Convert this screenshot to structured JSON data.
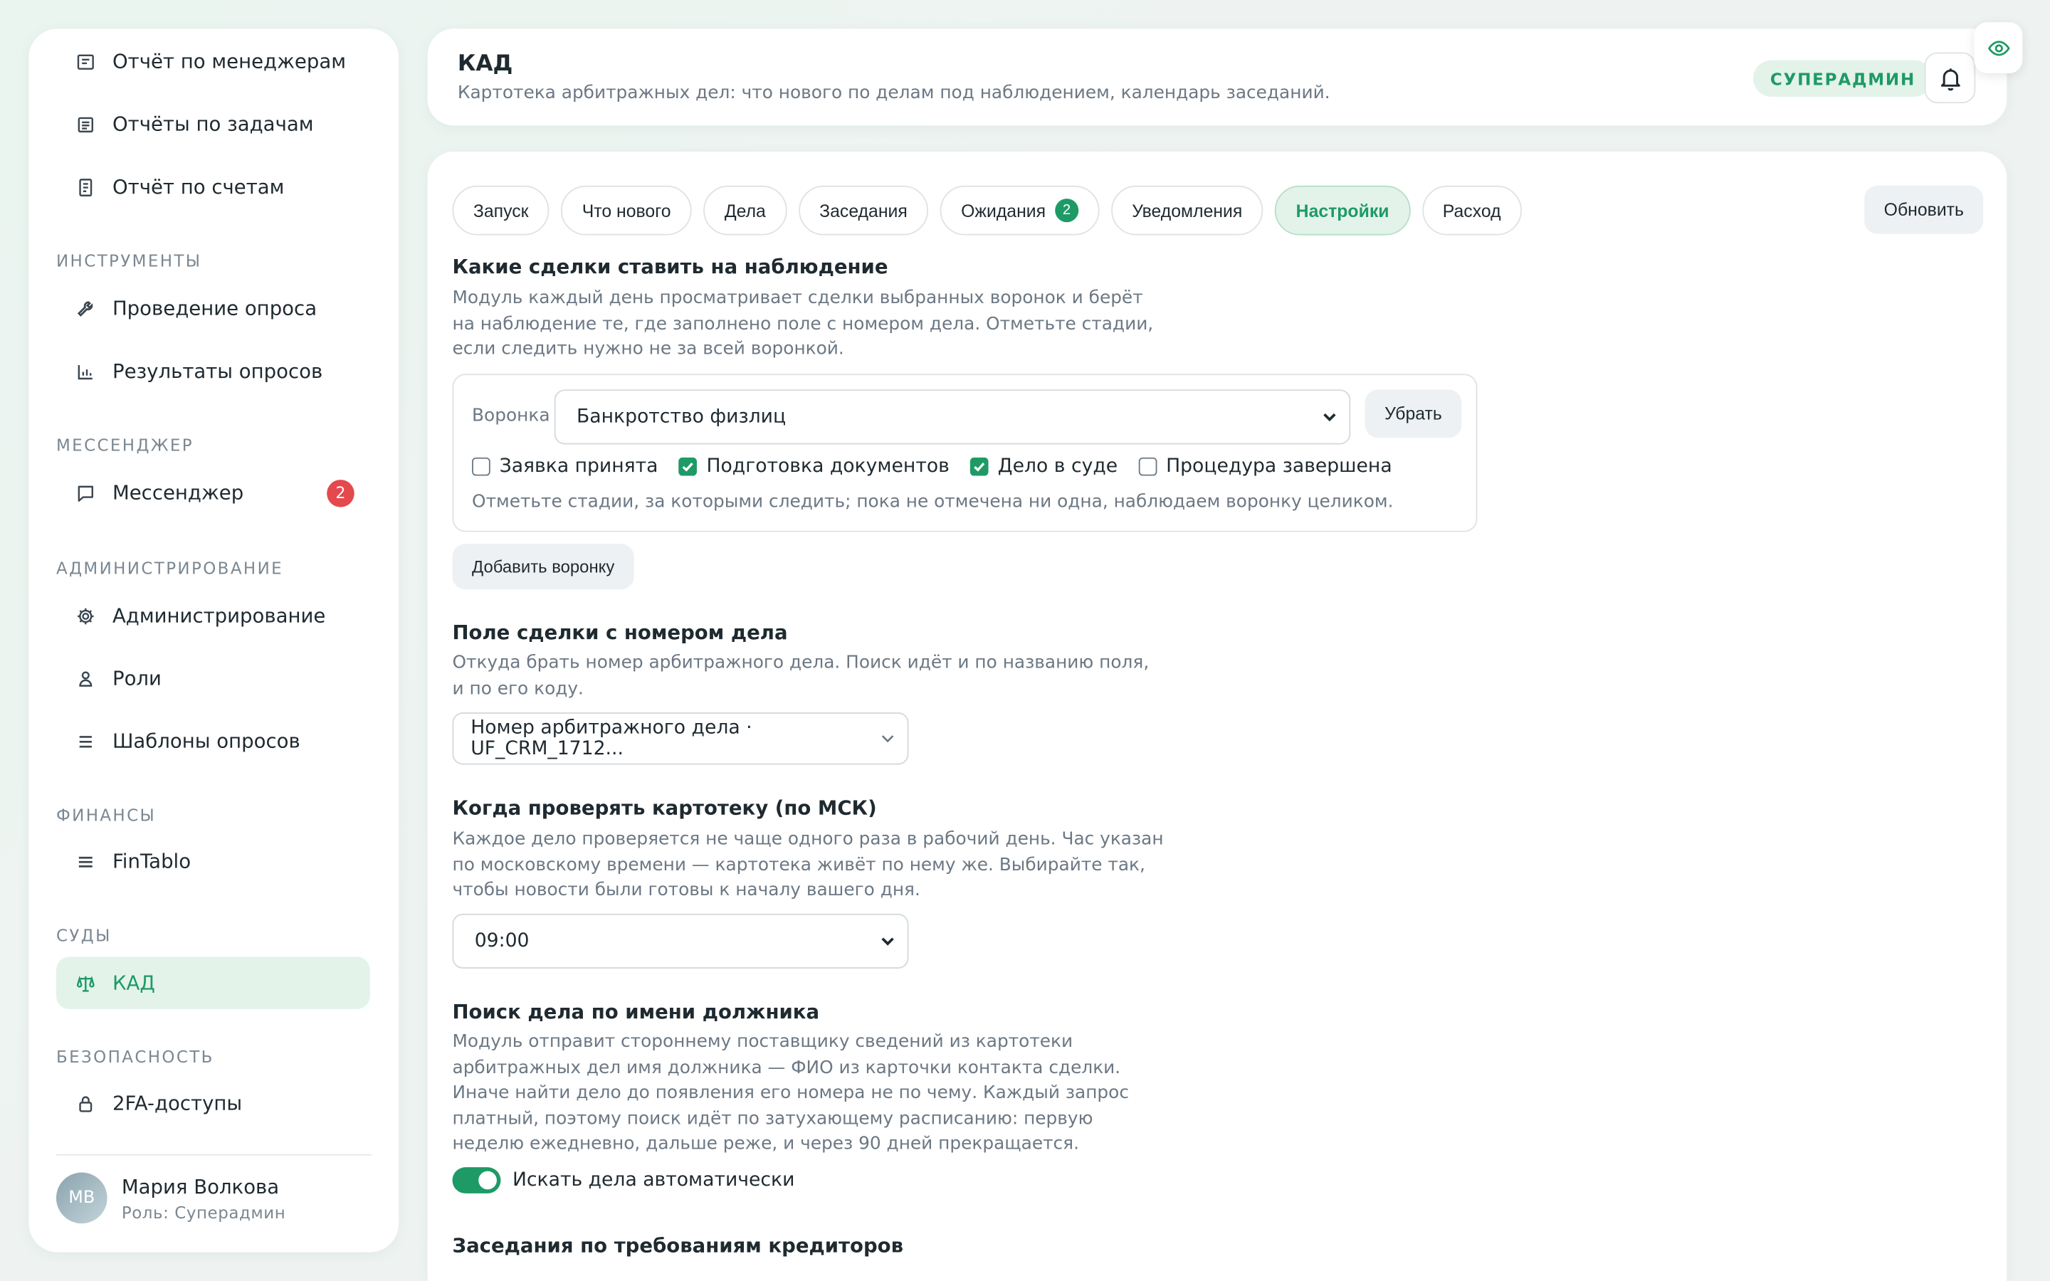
{
  "sidebar": {
    "items_top": [
      {
        "label": "Отчёт по менеджерам",
        "icon": "report-icon"
      },
      {
        "label": "Отчёты по задачам",
        "icon": "tasks-report-icon"
      },
      {
        "label": "Отчёт по счетам",
        "icon": "invoice-icon"
      }
    ],
    "sections": {
      "tools": "ИНСТРУМЕНТЫ",
      "messenger": "МЕССЕНДЖЕР",
      "admin": "АДМИНИСТРИРОВАНИЕ",
      "finance": "ФИНАНСЫ",
      "courts": "СУДЫ",
      "security": "БЕЗОПАСНОСТЬ"
    },
    "tools_items": [
      {
        "label": "Проведение опроса",
        "icon": "wrench-icon"
      },
      {
        "label": "Результаты опросов",
        "icon": "bar-chart-icon"
      }
    ],
    "messenger_item": {
      "label": "Мессенджер",
      "badge": "2",
      "icon": "chat-icon"
    },
    "admin_items": [
      {
        "label": "Администрирование",
        "icon": "gear-icon"
      },
      {
        "label": "Роли",
        "icon": "person-icon"
      },
      {
        "label": "Шаблоны опросов",
        "icon": "list-icon"
      }
    ],
    "finance_item": {
      "label": "FinTablo",
      "icon": "menu-icon"
    },
    "courts_item": {
      "label": "КАД",
      "icon": "scales-icon"
    },
    "security_item": {
      "label": "2FA-доступы",
      "icon": "lock-icon"
    },
    "user": {
      "initials": "МВ",
      "name": "Мария Волкова",
      "role": "Роль: Суперадмин"
    }
  },
  "header": {
    "title": "КАД",
    "subtitle": "Картотека арбитражных дел: что нового по делам под наблюдением, календарь заседаний.",
    "role_badge": "СУПЕРАДМИН"
  },
  "tabs": [
    {
      "label": "Запуск"
    },
    {
      "label": "Что нового"
    },
    {
      "label": "Дела"
    },
    {
      "label": "Заседания"
    },
    {
      "label": "Ожидания",
      "badge": "2"
    },
    {
      "label": "Уведомления"
    },
    {
      "label": "Настройки",
      "active": true
    },
    {
      "label": "Расход"
    }
  ],
  "refresh_label": "Обновить",
  "settings": {
    "deals": {
      "title": "Какие сделки ставить на наблюдение",
      "description": "Модуль каждый день просматривает сделки выбранных воронок и берёт на наблюдение те, где заполнено поле с номером дела. Отметьте стадии, если следить нужно не за всей воронкой.",
      "funnel_label": "Воронка",
      "funnel_value": "Банкротство физлиц",
      "remove_label": "Убрать",
      "stages": [
        {
          "label": "Заявка принята",
          "checked": false
        },
        {
          "label": "Подготовка документов",
          "checked": true
        },
        {
          "label": "Дело в суде",
          "checked": true
        },
        {
          "label": "Процедура завершена",
          "checked": false
        }
      ],
      "hint": "Отметьте стадии, за которыми следить; пока не отмечена ни одна, наблюдаем воронку целиком.",
      "add_label": "Добавить воронку"
    },
    "field": {
      "title": "Поле сделки с номером дела",
      "description": "Откуда брать номер арбитражного дела. Поиск идёт и по названию поля, и по его коду.",
      "value": "Номер арбитражного дела · UF_CRM_1712..."
    },
    "schedule": {
      "title": "Когда проверять картотеку (по МСК)",
      "description": "Каждое дело проверяется не чаще одного раза в рабочий день. Час указан по московскому времени — картотека живёт по нему же. Выбирайте так, чтобы новости были готовы к началу вашего дня.",
      "value": "09:00"
    },
    "debtor": {
      "title": "Поиск дела по имени должника",
      "description": "Модуль отправит стороннему поставщику сведений из картотеки арбитражных дел имя должника — ФИО из карточки контакта сделки. Иначе найти дело до появления его номера не по чему. Каждый запрос платный, поэтому поиск идёт по затухающему расписанию: первую неделю ежедневно, дальше реже, и через 90 дней прекращается.",
      "toggle_label": "Искать дела автоматически",
      "toggle_on": true
    },
    "creditors": {
      "title": "Заседания по требованиям кредиторов"
    }
  },
  "colors": {
    "accent": "#1e9a66",
    "accent_bg": "#e3f3ea",
    "badge_red": "#e5484d"
  }
}
